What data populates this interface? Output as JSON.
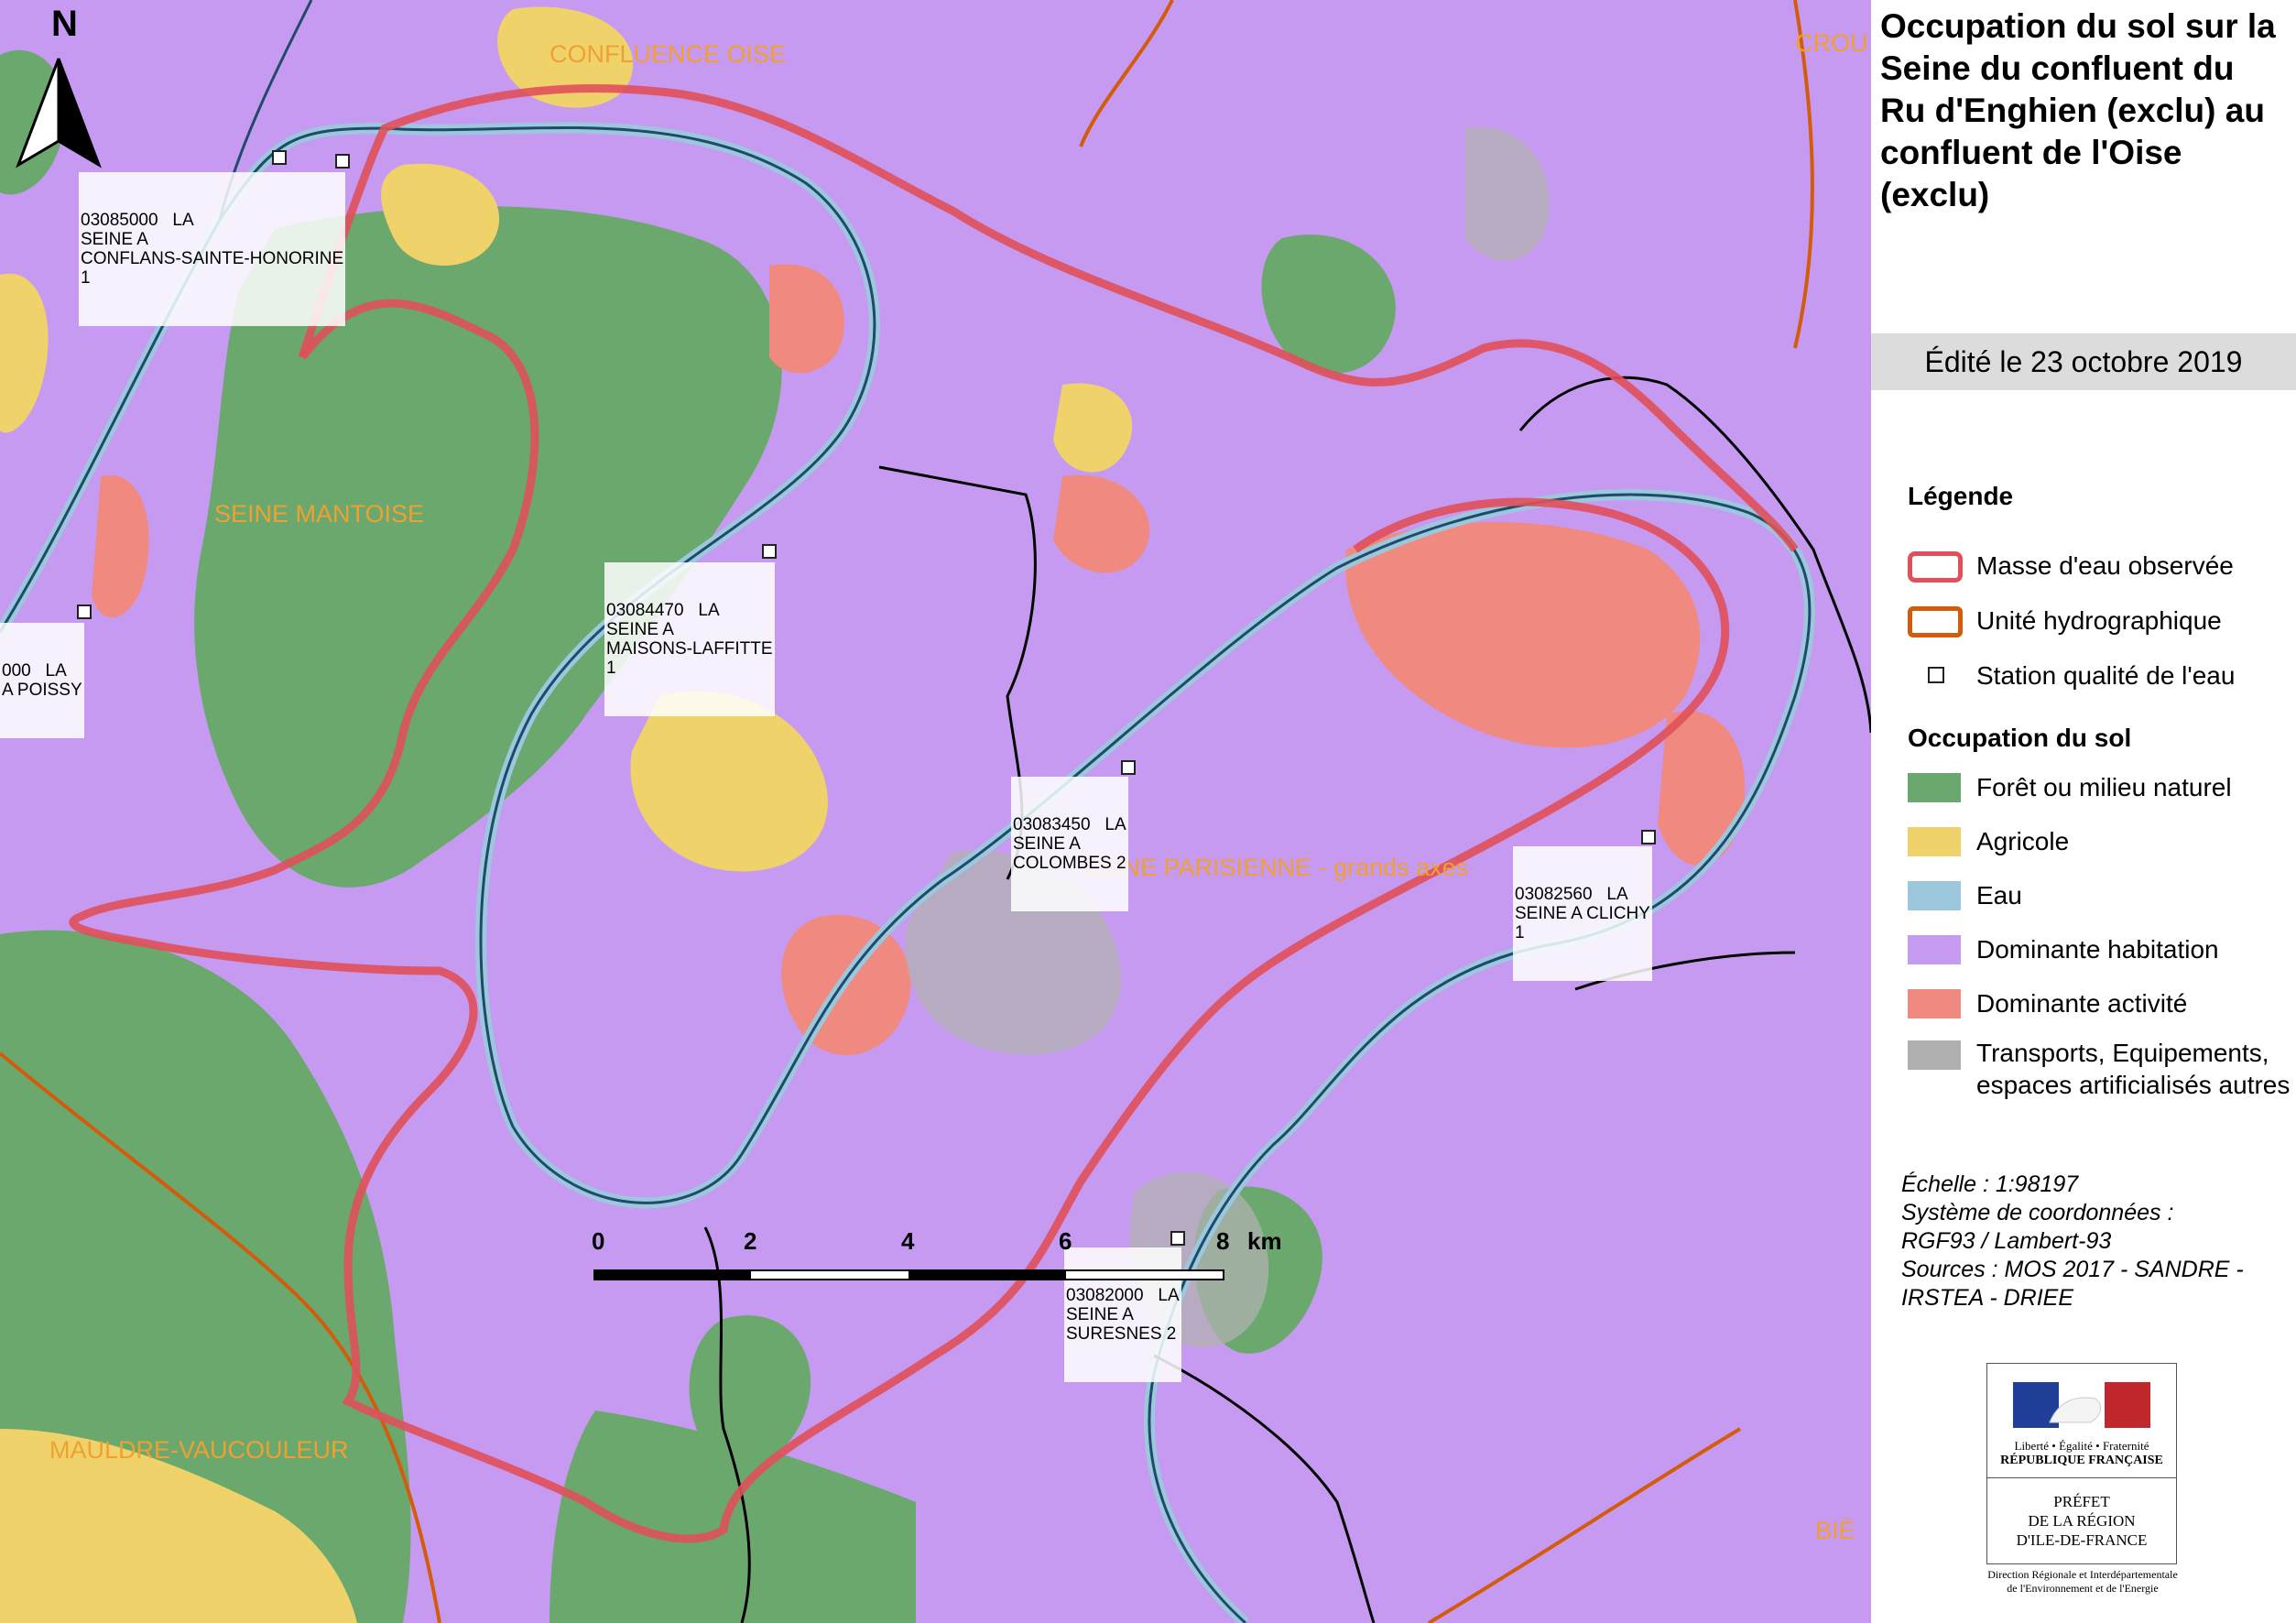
{
  "title": "Occupation du sol sur la Seine du confluent du Ru d'Enghien (exclu) au confluent de l'Oise (exclu)",
  "edited": "Édité le 23 octobre 2019",
  "north_label": "N",
  "legend": {
    "heading": "Légende",
    "items": [
      {
        "label": "Masse d'eau observée",
        "color": "#e0505a"
      },
      {
        "label": "Unité hydrographique",
        "color": "#d35c0c"
      },
      {
        "label": "Station qualité de l'eau",
        "color": "#ffffff"
      }
    ],
    "land_heading": "Occupation du sol",
    "land_items": [
      {
        "label": "Forêt ou milieu naturel",
        "color": "#6aa86e"
      },
      {
        "label": "Agricole",
        "color": "#efd36a"
      },
      {
        "label": "Eau",
        "color": "#9cc8de"
      },
      {
        "label": "Dominante habitation",
        "color": "#c79af2"
      },
      {
        "label": "Dominante activité",
        "color": "#f08a80"
      },
      {
        "label": "Transports, Equipements, espaces artificialisés autres",
        "color": "#b0b0b0"
      }
    ]
  },
  "meta": {
    "scale_line": "Échelle :  1:98197",
    "crs_line1": "Système de coordonnées :",
    "crs_line2": "RGF93 / Lambert-93",
    "sources_line1": "Sources : MOS 2017 - SANDRE -",
    "sources_line2": "IRSTEA - DRIEE"
  },
  "scale_bar": {
    "ticks": [
      "0",
      "2",
      "4",
      "6",
      "8"
    ],
    "unit": "km"
  },
  "stations": [
    {
      "code": "03085000   LA",
      "l2": "SEINE A",
      "l3": "CONFLANS-SAINTE-HONORINE",
      "l4": "1"
    },
    {
      "code": "03084470   LA",
      "l2": "SEINE A",
      "l3": "MAISONS-LAFFITTE",
      "l4": "1"
    },
    {
      "code": "03083450   LA",
      "l2": "SEINE A",
      "l3": "COLOMBES 2",
      "l4": ""
    },
    {
      "code": "03082560   LA",
      "l2": "SEINE A CLICHY",
      "l3": "1",
      "l4": ""
    },
    {
      "code": "03082000   LA",
      "l2": "SEINE A",
      "l3": "SURESNES 2",
      "l4": ""
    },
    {
      "code": "000   LA",
      "l2": "A POISSY",
      "l3": "",
      "l4": ""
    }
  ],
  "zones": {
    "confluence_oise": "CONFLUENCE OISE",
    "seine_mantoise": "SEINE MANTOISE",
    "seine_parisienne": "SEINE PARISIENNE - grands axes",
    "mauldre": "MAULDRE-VAUCOULEUR",
    "crou": "CROU",
    "bie": "BIÈ"
  },
  "logo": {
    "motto": "Liberté • Égalité • Fraternité",
    "republic": "RÉPUBLIQUE FRANÇAISE",
    "prefet": "PRÉFET",
    "prefet2": "DE LA RÉGION",
    "prefet3": "D'ILE-DE-FRANCE",
    "note1": "Direction Régionale et Interdépartementale",
    "note2": "de l'Environnement et de l'Energie"
  }
}
